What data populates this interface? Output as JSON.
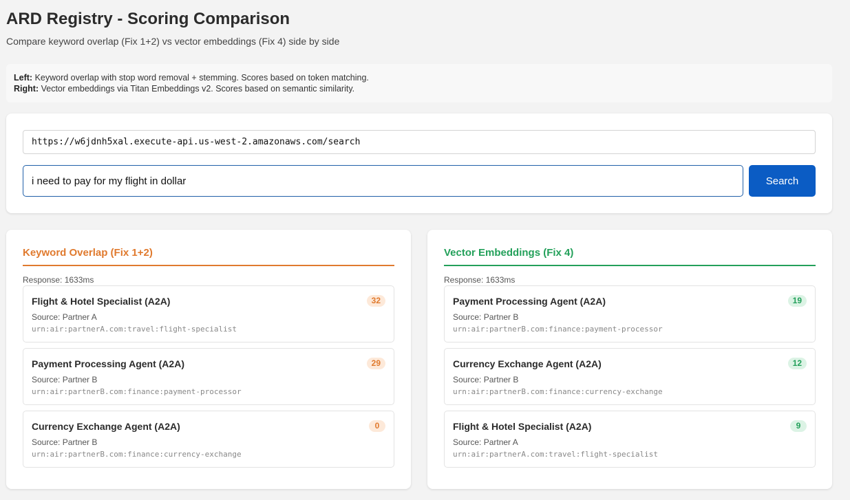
{
  "header": {
    "title": "ARD Registry - Scoring Comparison",
    "subtitle": "Compare keyword overlap (Fix 1+2) vs vector embeddings (Fix 4) side by side"
  },
  "info": {
    "left_label": "Left:",
    "left_text": "Keyword overlap with stop word removal + stemming. Scores based on token matching.",
    "right_label": "Right:",
    "right_text": "Vector embeddings via Titan Embeddings v2. Scores based on semantic similarity."
  },
  "search": {
    "endpoint_value": "https://w6jdnh5xal.execute-api.us-west-2.amazonaws.com/search",
    "query_value": "i need to pay for my flight in dollar",
    "button_label": "Search"
  },
  "colors": {
    "keyword_accent": "#e07a2e",
    "vector_accent": "#23a05a",
    "primary_button": "#0b5cc4"
  },
  "keyword_panel": {
    "title": "Keyword Overlap (Fix 1+2)",
    "response": "Response: 1633ms",
    "results": [
      {
        "name": "Flight & Hotel Specialist (A2A)",
        "source": "Source: Partner A",
        "urn": "urn:air:partnerA.com:travel:flight-specialist",
        "score": "32"
      },
      {
        "name": "Payment Processing Agent (A2A)",
        "source": "Source: Partner B",
        "urn": "urn:air:partnerB.com:finance:payment-processor",
        "score": "29"
      },
      {
        "name": "Currency Exchange Agent (A2A)",
        "source": "Source: Partner B",
        "urn": "urn:air:partnerB.com:finance:currency-exchange",
        "score": "0"
      }
    ]
  },
  "vector_panel": {
    "title": "Vector Embeddings (Fix 4)",
    "response": "Response: 1633ms",
    "results": [
      {
        "name": "Payment Processing Agent (A2A)",
        "source": "Source: Partner B",
        "urn": "urn:air:partnerB.com:finance:payment-processor",
        "score": "19"
      },
      {
        "name": "Currency Exchange Agent (A2A)",
        "source": "Source: Partner B",
        "urn": "urn:air:partnerB.com:finance:currency-exchange",
        "score": "12"
      },
      {
        "name": "Flight & Hotel Specialist (A2A)",
        "source": "Source: Partner A",
        "urn": "urn:air:partnerA.com:travel:flight-specialist",
        "score": "9"
      }
    ]
  }
}
